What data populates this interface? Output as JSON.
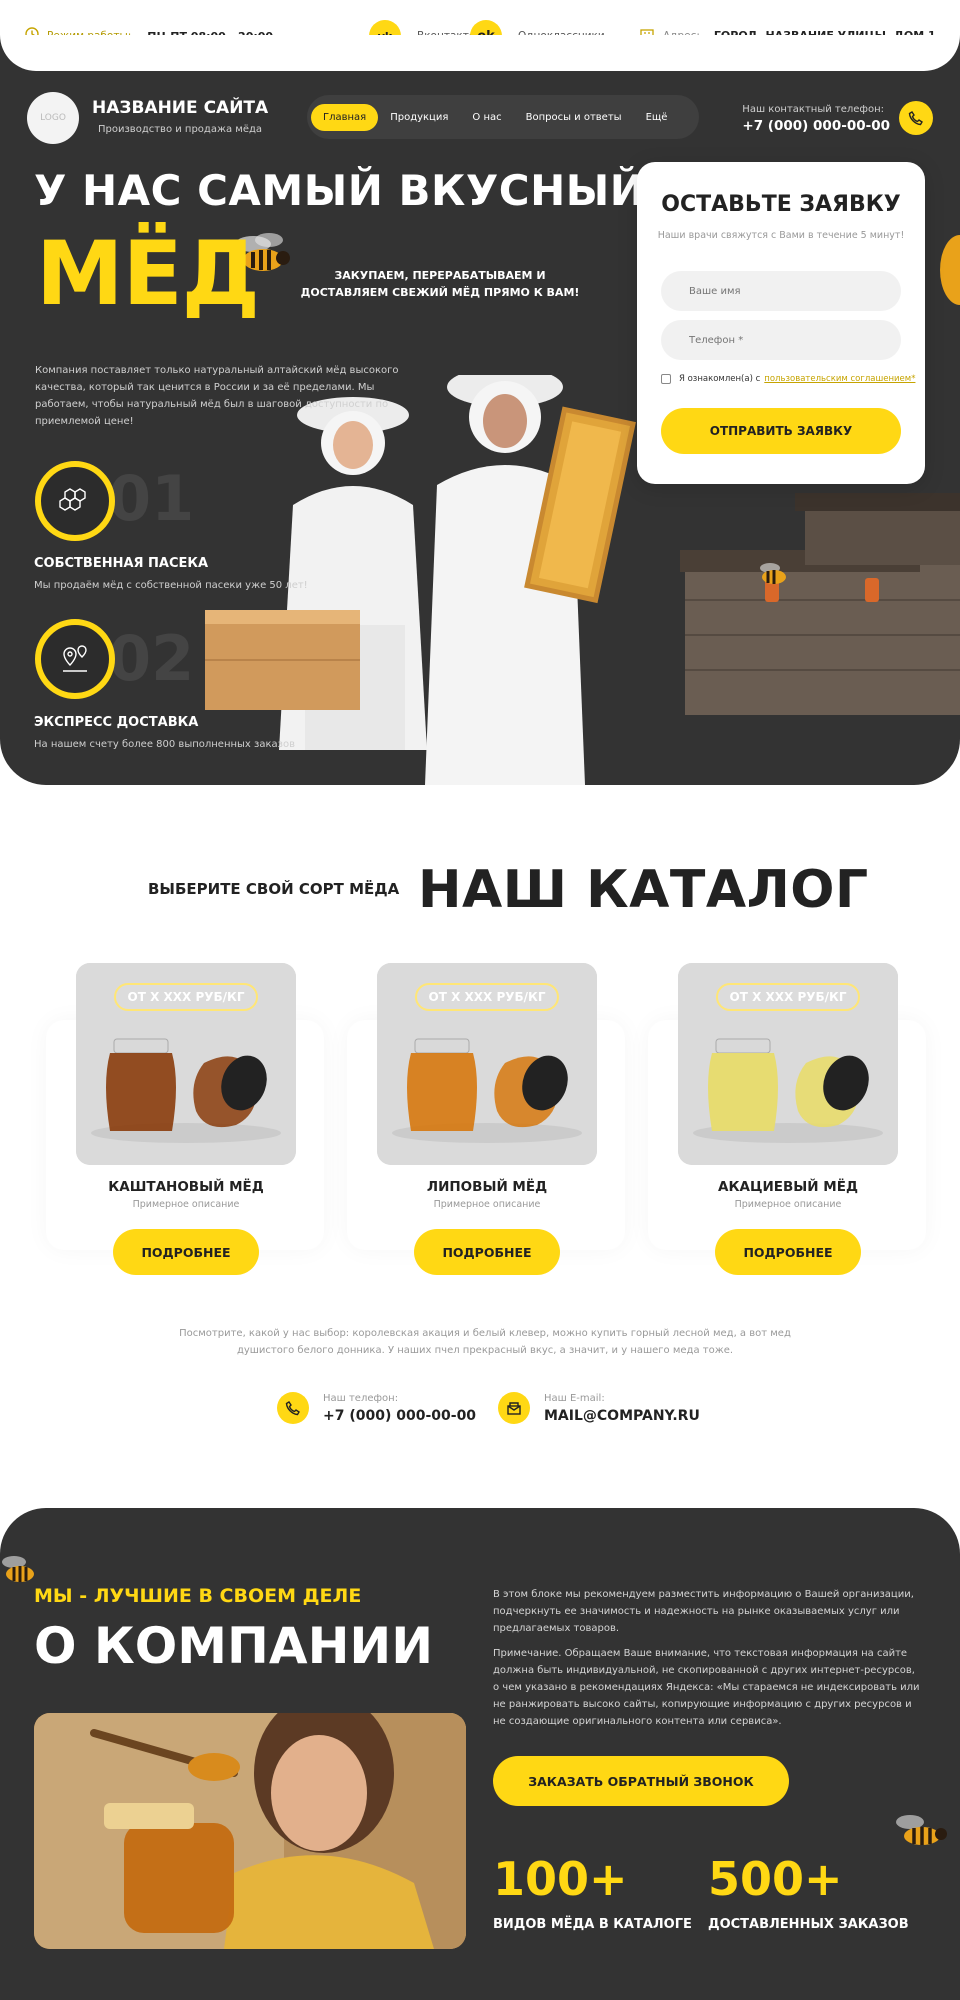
{
  "topbar": {
    "hours_label": "Режим работы:",
    "hours_value": "ПН-ПТ 08:00 - 20:00",
    "vk_label": "Вконтакте",
    "ok_label": "Одноклассники",
    "address_label": "Адрес:",
    "address_value": "ГОРОД, НАЗВАНИЕ УЛИЦЫ, ДОМ 1"
  },
  "header": {
    "logo_text": "LOGO",
    "site_title": "НАЗВАНИЕ САЙТА",
    "site_subtitle": "Производство и продажа мёда",
    "nav": [
      {
        "label": "Главная"
      },
      {
        "label": "Продукция"
      },
      {
        "label": "О нас"
      },
      {
        "label": "Вопросы и ответы"
      },
      {
        "label": "Ещё"
      }
    ],
    "contact_label": "Наш контактный телефон:",
    "contact_phone": "+7 (000) 000-00-00"
  },
  "hero": {
    "title_line1": "У НАС САМЫЙ ВКУСНЫЙ",
    "title_line2": "МЁД",
    "tagline": "ЗАКУПАЕМ, ПЕРЕРАБАТЫВАЕМ И ДОСТАВЛЯЕМ СВЕЖИЙ МЁД ПРЯМО К ВАМ!",
    "description": "Компания поставляет только натуральный алтайский мёд высокого качества, который так ценится в России и за её пределами. Мы работаем, чтобы натуральный мёд был в шаговой доступности по приемлемой цене!",
    "features": [
      {
        "num": "01",
        "title": "СОБСТВЕННАЯ ПАСЕКА",
        "desc": "Мы продаём мёд с собственной пасеки уже 50 лет!"
      },
      {
        "num": "02",
        "title": "ЭКСПРЕСС ДОСТАВКА",
        "desc": "На нашем счету более 800 выполненных заказов"
      }
    ]
  },
  "form": {
    "title": "ОСТАВЬТЕ ЗАЯВКУ",
    "subtitle": "Наши врачи свяжутся с Вами в течение 5 минут!",
    "name_placeholder": "Ваше имя",
    "phone_placeholder": "Телефон *",
    "consent_text": "Я ознакомлен(а) с",
    "consent_link": "пользовательским соглашением*",
    "submit_label": "ОТПРАВИТЬ ЗАЯВКУ"
  },
  "catalog": {
    "subtitle": "ВЫБЕРИТЕ СВОЙ СОРТ МЁДА",
    "title": "НАШ КАТАЛОГ",
    "products": [
      {
        "price": "ОТ Х ХХХ РУБ/КГ",
        "name": "КАШТАНОВЫЙ МЁД",
        "desc": "Примерное описание",
        "button": "ПОДРОБНЕЕ",
        "honey_color": "#8a3c0c"
      },
      {
        "price": "ОТ Х ХХХ РУБ/КГ",
        "name": "ЛИПОВЫЙ МЁД",
        "desc": "Примерное описание",
        "button": "ПОДРОБНЕЕ",
        "honey_color": "#d6780e"
      },
      {
        "price": "ОТ Х ХХХ РУБ/КГ",
        "name": "АКАЦИЕВЫЙ МЁД",
        "desc": "Примерное описание",
        "button": "ПОДРОБНЕЕ",
        "honey_color": "#e8dc6c"
      }
    ],
    "note": "Посмотрите, какой у нас выбор: королевская акация и белый клевер, можно купить горный лесной мед, а вот мед душистого белого донника. У наших пчел прекрасный вкус, а значит, и у нашего меда тоже.",
    "phone_label": "Наш телефон:",
    "phone_value": "+7 (000) 000-00-00",
    "email_label": "Наш E-mail:",
    "email_value": "MAIL@COMPANY.RU"
  },
  "about": {
    "kicker": "МЫ - ЛУЧШИЕ В СВОЕМ ДЕЛЕ",
    "title": "О КОМПАНИИ",
    "text1": "В этом блоке мы рекомендуем разместить информацию о Вашей организации, подчеркнуть ее значимость и надежность на рынке оказываемых услуг или предлагаемых товаров.",
    "text2": "Примечание. Обращаем Ваше внимание, что текстовая информация на сайте должна быть индивидуальной, не скопированной с других интернет-ресурсов, о чем указано в рекомендациях Яндекса: «Мы стараемся не индексировать или не ранжировать высоко сайты, копирующие информацию с других ресурсов и не создающие оригинального контента или сервиса».",
    "button": "ЗАКАЗАТЬ ОБРАТНЫЙ ЗВОНОК",
    "stats": [
      {
        "value": "100+",
        "label": "ВИДОВ МЁДА В КАТАЛОГЕ"
      },
      {
        "value": "500+",
        "label": "ДОСТАВЛЕННЫХ ЗАКАЗОВ"
      }
    ]
  },
  "colors": {
    "accent": "#ffd814",
    "dark": "#333333"
  }
}
